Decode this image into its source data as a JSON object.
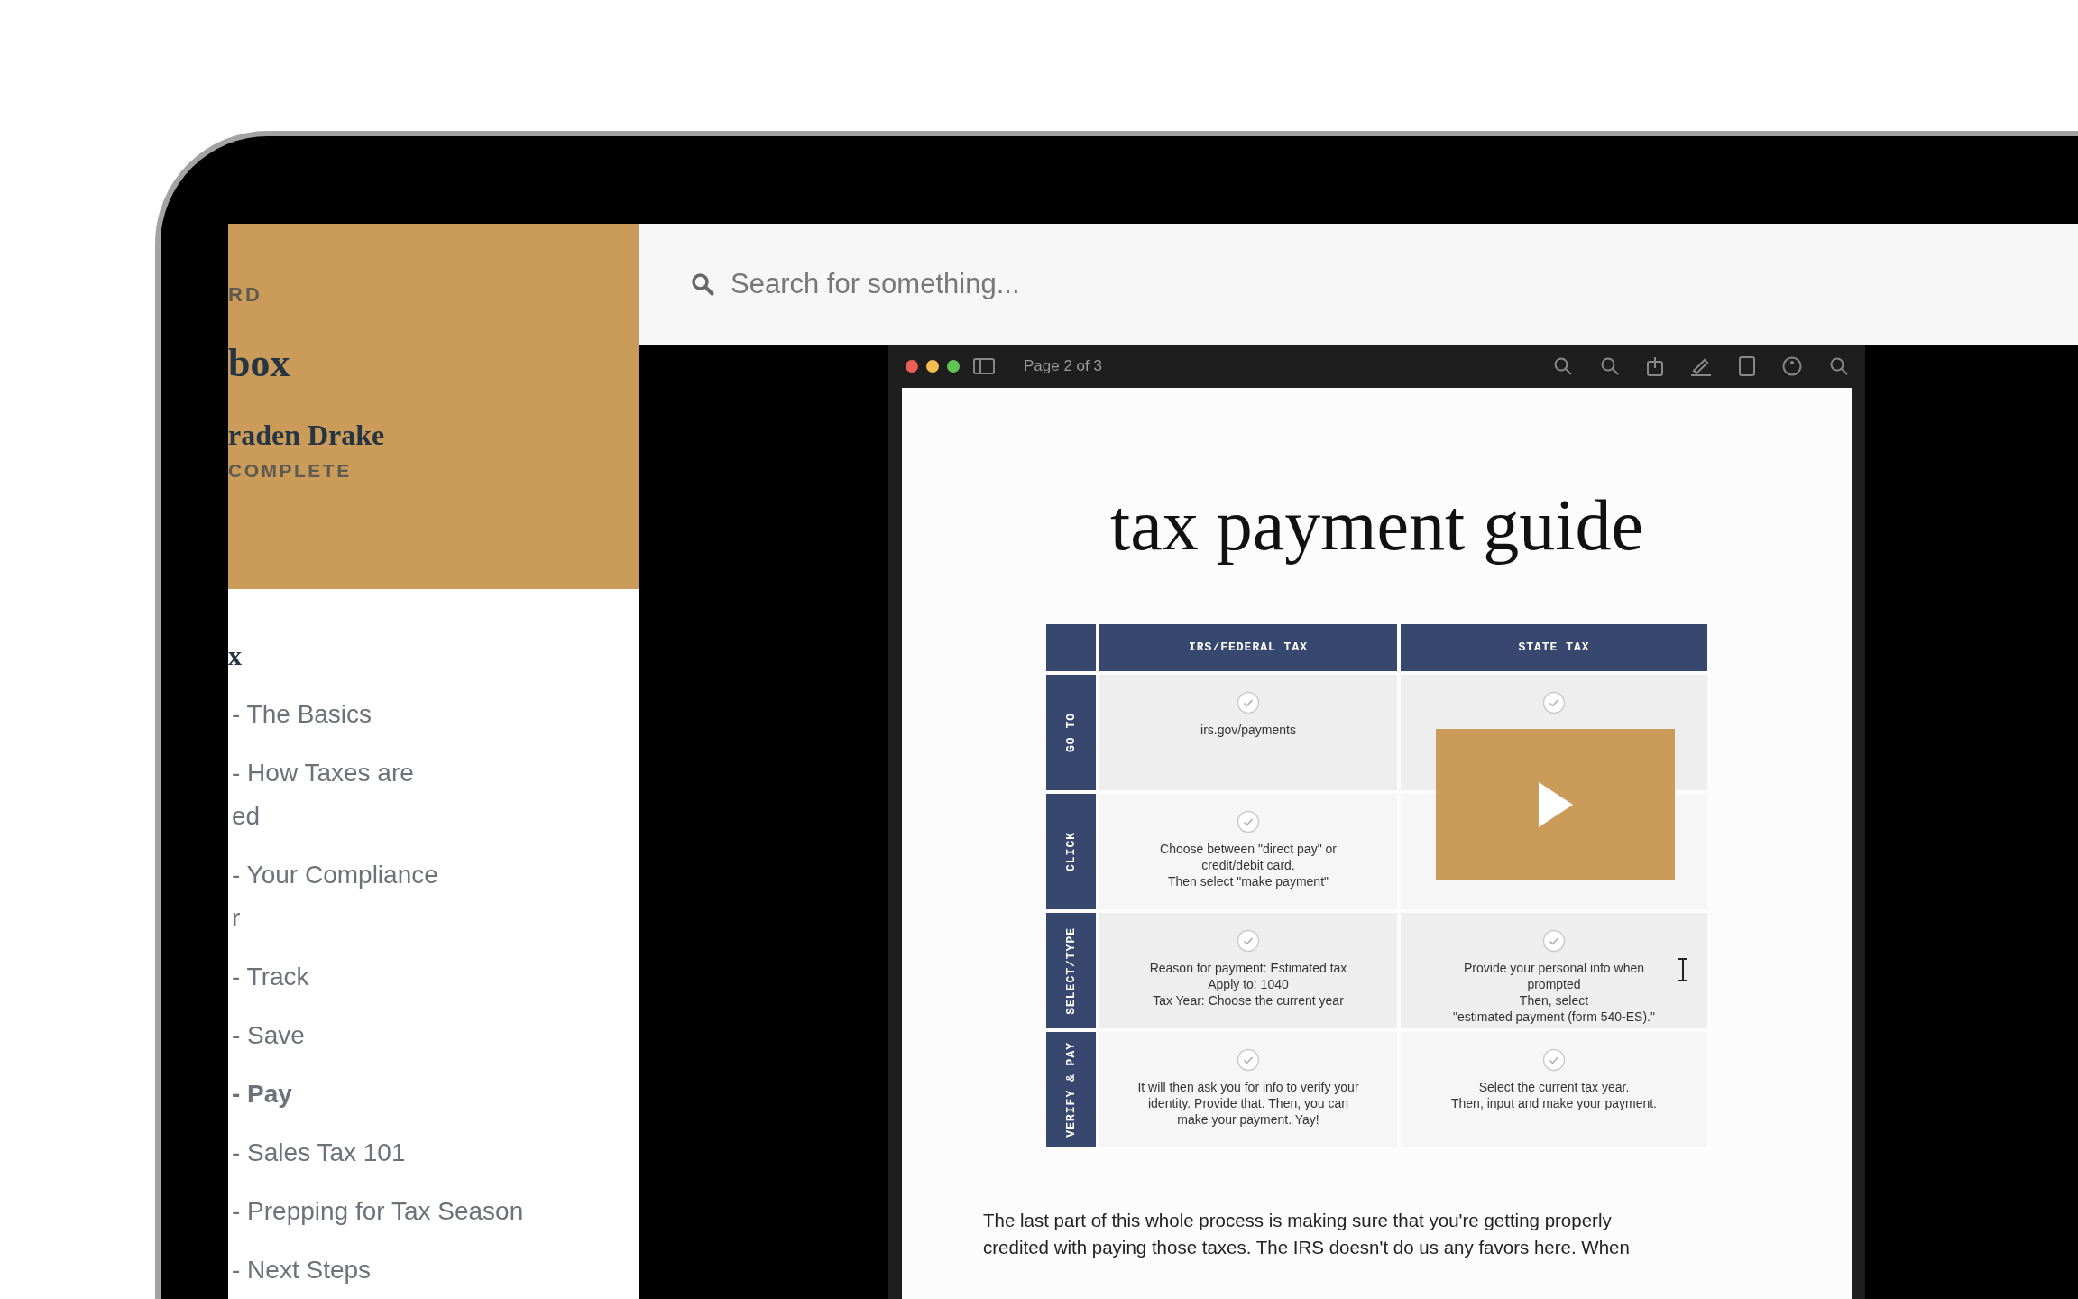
{
  "sidebar": {
    "header": {
      "eyebrow": "RD",
      "title": "box",
      "student": "raden Drake",
      "progress": "COMPLETE"
    },
    "items": [
      {
        "kind": "heading",
        "lines": [
          "x"
        ]
      },
      {
        "kind": "lesson",
        "lines": [
          "- The Basics"
        ],
        "selected": false
      },
      {
        "kind": "lesson",
        "lines": [
          "- How Taxes are",
          "ed"
        ],
        "selected": false
      },
      {
        "kind": "lesson",
        "lines": [
          "- Your Compliance",
          "r"
        ],
        "selected": false
      },
      {
        "kind": "lesson",
        "lines": [
          "- Track"
        ],
        "selected": false
      },
      {
        "kind": "lesson",
        "lines": [
          "- Save"
        ],
        "selected": false
      },
      {
        "kind": "lesson",
        "lines": [
          "- Pay"
        ],
        "selected": true
      },
      {
        "kind": "lesson",
        "lines": [
          "- Sales Tax 101"
        ],
        "selected": false
      },
      {
        "kind": "lesson",
        "lines": [
          "- Prepping for Tax Season"
        ],
        "selected": false
      },
      {
        "kind": "lesson",
        "lines": [
          "- Next Steps"
        ],
        "selected": false
      }
    ]
  },
  "search": {
    "placeholder": "Search for something..."
  },
  "video": {
    "viewer": {
      "page_label": "Page 2 of 3"
    },
    "document": {
      "title": "tax payment guide",
      "table": {
        "columns": [
          "IRS/FEDERAL TAX",
          "STATE TAX"
        ],
        "rows": [
          {
            "label": "GO TO",
            "cells": [
              {
                "lines": [
                  "irs.gov/payments"
                ]
              },
              {}
            ]
          },
          {
            "label": "CLICK",
            "cells": [
              {
                "lines": [
                  "Choose between \"direct pay\" or",
                  "credit/debit card.",
                  "Then select \"make payment\""
                ]
              },
              {}
            ]
          },
          {
            "label": "SELECT/TYPE",
            "cells": [
              {
                "lines": [
                  "Reason for payment: Estimated tax",
                  "Apply to: 1040",
                  "Tax Year: Choose the current year"
                ]
              },
              {
                "lines": [
                  "Provide your personal info when",
                  "prompted",
                  "Then, select",
                  "\"estimated payment (form 540-ES).\""
                ]
              }
            ]
          },
          {
            "label": "VERIFY & PAY",
            "cells": [
              {
                "lines": [
                  "It will then ask you for info to verify your",
                  "identity. Provide that. Then, you can",
                  "make your payment. Yay!"
                ]
              },
              {
                "lines": [
                  "Select the current tax year.",
                  "Then, input and make your payment."
                ]
              }
            ]
          }
        ]
      },
      "paragraph": [
        "The last part of this whole process is making sure that you're getting properly",
        "credited with paying those taxes. The IRS doesn't do us any favors here. When"
      ]
    }
  }
}
